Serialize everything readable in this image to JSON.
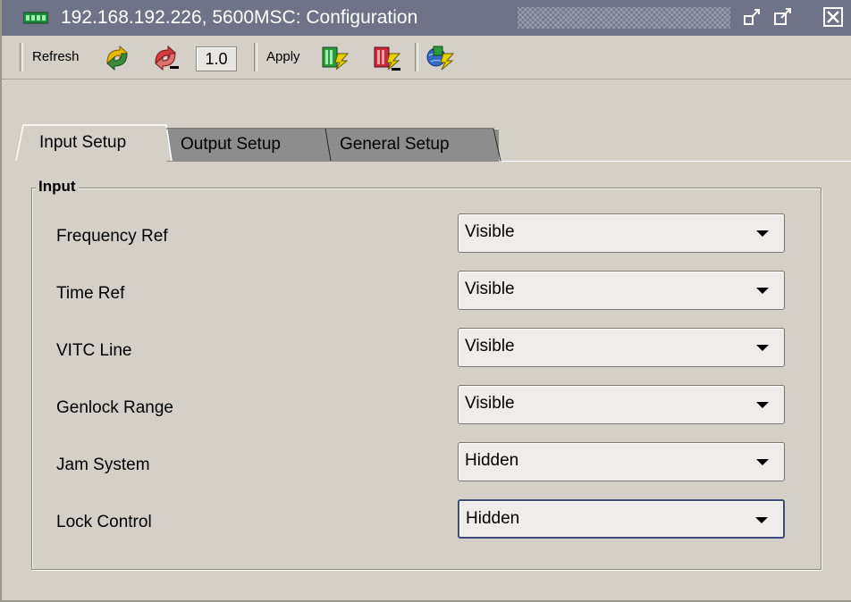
{
  "window": {
    "title": "192.168.192.226, 5600MSC: Configuration",
    "title_icon": "device-icon",
    "controls": [
      "detach-icon",
      "maximize-icon",
      "close-icon"
    ]
  },
  "toolbar": {
    "refresh_label": "Refresh",
    "refresh_icons": [
      "refresh-all-icon",
      "refresh-single-icon"
    ],
    "zoom_value": "1.0",
    "apply_label": "Apply",
    "apply_icons": [
      "apply-green-icon",
      "apply-red-icon",
      "apply-globe-icon"
    ]
  },
  "tabs": [
    {
      "label": "Input Setup",
      "active": true
    },
    {
      "label": "Output Setup",
      "active": false
    },
    {
      "label": "General Setup",
      "active": false
    }
  ],
  "input_group": {
    "title": "Input",
    "rows": [
      {
        "label": "Frequency Ref",
        "value": "Visible"
      },
      {
        "label": "Time Ref",
        "value": "Visible"
      },
      {
        "label": "VITC Line",
        "value": "Visible"
      },
      {
        "label": "Genlock Range",
        "value": "Visible"
      },
      {
        "label": "Jam System",
        "value": "Hidden"
      },
      {
        "label": "Lock Control",
        "value": "Hidden"
      }
    ]
  },
  "colors": {
    "titlebar": "#6e7387",
    "panel": "#d4d0c8",
    "inactive_tab": "#8d8d8d",
    "focus_border": "#3e4a7c"
  }
}
